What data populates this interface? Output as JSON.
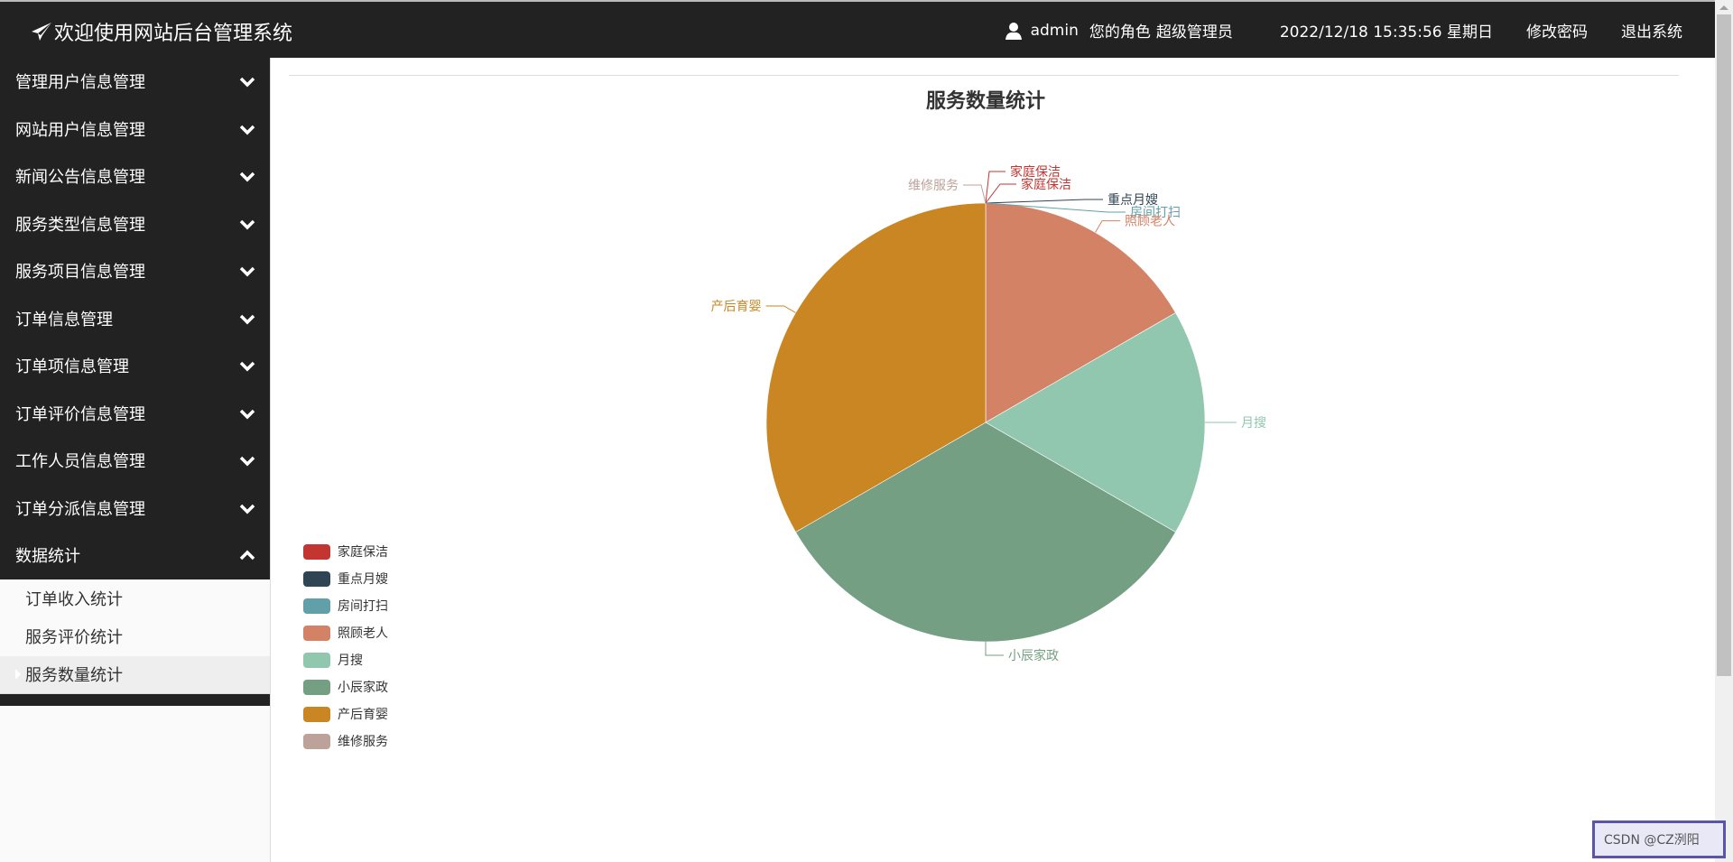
{
  "header": {
    "title": "欢迎使用网站后台管理系统",
    "username": "admin",
    "role_label": "您的角色",
    "role_value": "超级管理员",
    "datetime": "2022/12/18 15:35:56 星期日",
    "change_password": "修改密码",
    "logout": "退出系统"
  },
  "sidebar": {
    "items": [
      {
        "label": "管理用户信息管理",
        "expanded": false
      },
      {
        "label": "网站用户信息管理",
        "expanded": false
      },
      {
        "label": "新闻公告信息管理",
        "expanded": false
      },
      {
        "label": "服务类型信息管理",
        "expanded": false
      },
      {
        "label": "服务项目信息管理",
        "expanded": false
      },
      {
        "label": "订单信息管理",
        "expanded": false
      },
      {
        "label": "订单项信息管理",
        "expanded": false
      },
      {
        "label": "订单评价信息管理",
        "expanded": false
      },
      {
        "label": "工作人员信息管理",
        "expanded": false
      },
      {
        "label": "订单分派信息管理",
        "expanded": false
      },
      {
        "label": "数据统计",
        "expanded": true
      }
    ],
    "submenu": [
      {
        "label": "订单收入统计",
        "active": false
      },
      {
        "label": "服务评价统计",
        "active": false
      },
      {
        "label": "服务数量统计",
        "active": true
      }
    ]
  },
  "watermark": "CSDN @CZ洌阳",
  "chart_data": {
    "type": "pie",
    "title": "服务数量统计",
    "legend_position": "left-bottom",
    "legend": [
      "家庭保洁",
      "重点月嫂",
      "房间打扫",
      "照顾老人",
      "月搜",
      "小辰家政",
      "产后育婴",
      "维修服务"
    ],
    "slices": [
      {
        "name": "家庭保洁",
        "value": 0,
        "color": "#c23531"
      },
      {
        "name": "重点月嫂",
        "value": 0,
        "color": "#2f4554"
      },
      {
        "name": "房间打扫",
        "value": 0,
        "color": "#61a0a8"
      },
      {
        "name": "照顾老人",
        "value": 1,
        "color": "#d48265"
      },
      {
        "name": "月搜",
        "value": 1,
        "color": "#91c7ae"
      },
      {
        "name": "小辰家政",
        "value": 2,
        "color": "#749f83"
      },
      {
        "name": "产后育婴",
        "value": 2,
        "color": "#ca8622"
      },
      {
        "name": "维修服务",
        "value": 0,
        "color": "#bda29a"
      },
      {
        "name": "家庭保洁",
        "value": 0,
        "color": "#c23531"
      }
    ],
    "legend_colors": [
      "#c23531",
      "#2f4554",
      "#61a0a8",
      "#d48265",
      "#91c7ae",
      "#749f83",
      "#ca8622",
      "#bda29a"
    ]
  }
}
